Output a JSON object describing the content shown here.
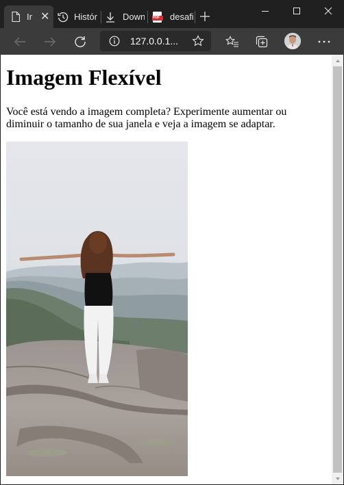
{
  "browser": {
    "tabs": [
      {
        "label": "Ir",
        "icon": "page-icon",
        "active": true
      },
      {
        "label": "Histór",
        "icon": "history-icon",
        "active": false
      },
      {
        "label": "Down",
        "icon": "download-icon",
        "active": false
      },
      {
        "label": "desafi",
        "icon": "pdf-icon",
        "active": false
      }
    ],
    "pdf_icon_text": "PDF",
    "address": "127.0.0.1...",
    "accent_colors": {
      "frame": "#202020",
      "toolbar": "#3b3b3b",
      "omnibox": "#2a2a2a",
      "pdf": "#d32f2f"
    }
  },
  "page": {
    "title": "Imagem Flexível",
    "text": "Você está vendo a imagem completa? Experimente aumentar ou diminuir o tamanho de sua janela e veja a imagem se adaptar."
  }
}
